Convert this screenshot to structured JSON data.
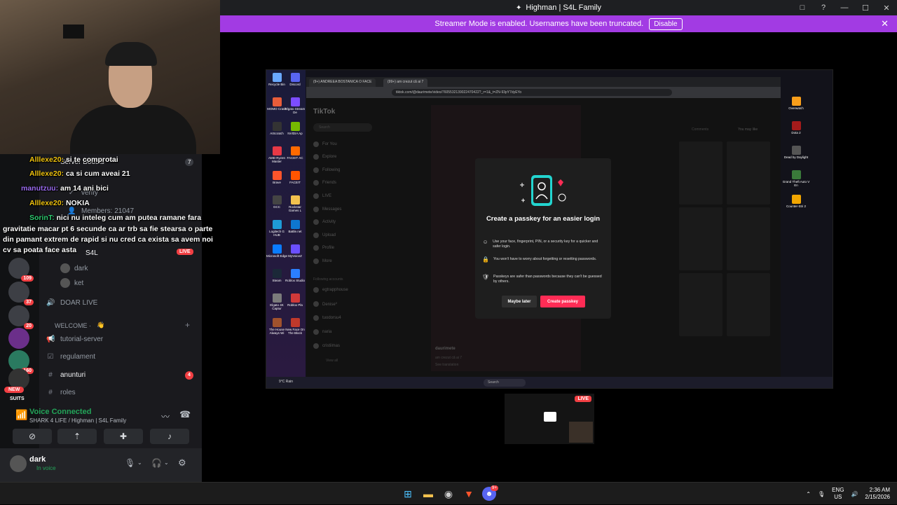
{
  "window": {
    "title": "Highman | S4L Family",
    "controls": [
      "□",
      "?",
      "—",
      "☐",
      "✕"
    ]
  },
  "streamer_bar": {
    "text": "Streamer Mode is enabled. Usernames have been truncated.",
    "button": "Disable",
    "close": "✕"
  },
  "chat": [
    {
      "user": "Alllexe20:",
      "msg": "si te comprotai"
    },
    {
      "user": "Alllexe20:",
      "msg": "ca si cum aveai 21"
    },
    {
      "user": "manutzuu:",
      "msg": "am 14 ani bici"
    },
    {
      "user": "Alllexe20:",
      "msg": "NOKIA"
    },
    {
      "user": "SorinT:",
      "msg": "nici nu inteleg cum am putea ramane fara"
    },
    {
      "user": "",
      "msg": "gravitatie macar pt 6 secunde ca ar trb sa fie stearsa o parte"
    },
    {
      "user": "",
      "msg": "din pamant extrem de rapid si nu cred ca exista sa avem noi"
    },
    {
      "user": "",
      "msg": "cv sa poata face asta"
    }
  ],
  "sidebar": {
    "server_boosts": "Server Boosts",
    "boost_count": "7",
    "verify": "verify",
    "members": "Members: 21047",
    "s4l_label": "S4L",
    "live_badge": "LIVE",
    "voice_members": [
      "dark",
      "ket"
    ],
    "channels": [
      {
        "label": "DOAR LIVE"
      },
      {
        "label": "WELCOME ·",
        "category": true
      },
      {
        "label": "tutorial-server"
      },
      {
        "label": "regulament"
      },
      {
        "label": "anunturi",
        "badge": "4"
      },
      {
        "label": "roles"
      }
    ],
    "guild_badges": [
      "109",
      "37",
      "20",
      "160",
      "208"
    ],
    "new_badge": "NEW",
    "suits": "SUITS"
  },
  "voice": {
    "status": "Voice Connected",
    "channel": "SHARK 4 LIFE / Highman | S4L Family"
  },
  "user": {
    "name": "dark",
    "status": "In voice"
  },
  "stream": {
    "browser_tabs": [
      "(9+) ANDREEA BOSTANICA O FACE",
      "(99+) am crezut că ai 7"
    ],
    "url": "tiktok.com/@daurimete/video/7605532139022470422?_r=1&_t=ZN-93pY7dyEYo",
    "tiktok_logo": "TikTok",
    "search": "Search",
    "nav": [
      "For You",
      "Explore",
      "Following",
      "Friends",
      "LIVE",
      "Messages",
      "Activity",
      "Upload",
      "Profile",
      "More"
    ],
    "following_accounts": "Following accounts",
    "accounts": [
      "egtrapphouse",
      "Denise⁰",
      "tuodorsu4",
      "naria",
      "cristiimas"
    ],
    "view_all": "View all",
    "tabs_right": [
      "Comments",
      "You may like"
    ],
    "video_author": "daurimete",
    "video_caption": "am crezut că ai 7",
    "see_translation": "See translation",
    "desktop_icons": [
      "Recycle Bin",
      "Discord",
      "MOMO Crash",
      "Elgato Stream De",
      "AIScratch",
      "NVIDIA Ap",
      "AMD Ryzen Master",
      "FACEIT AC",
      "Brave",
      "FACEIT",
      "GCC",
      "Rockstar Games L",
      "Logitech G HUB",
      "Battle.net",
      "Microsoft Edge",
      "MyVoiceZ",
      "Steam",
      "Roblox Studio",
      "Elgato 4K Captur",
      "Roblox Pla",
      "The House Always Wi",
      "New Face On The Block"
    ],
    "desktop_icons_right": [
      "Overwatch",
      "Dota 2",
      "Dead by Daylight",
      "Grand Theft Auto V En",
      "Counter-Stri 2"
    ],
    "remote_taskbar_search": "Search",
    "weather": "9°C Rain"
  },
  "modal": {
    "title": "Create a passkey for an easier login",
    "rows": [
      "Use your face, fingerprint, PIN, or a security key for a quicker and safer login.",
      "You won't have to worry about forgetting or resetting passwords.",
      "Passkeys are safer than passwords because they can't be guessed by others."
    ],
    "maybe_later": "Maybe later",
    "create": "Create passkey"
  },
  "preview": {
    "live": "LIVE"
  },
  "taskbar": {
    "lang_top": "ENG",
    "lang_bottom": "US",
    "time": "2:36 AM",
    "date": "2/15/2026",
    "discord_badge": "9+"
  }
}
